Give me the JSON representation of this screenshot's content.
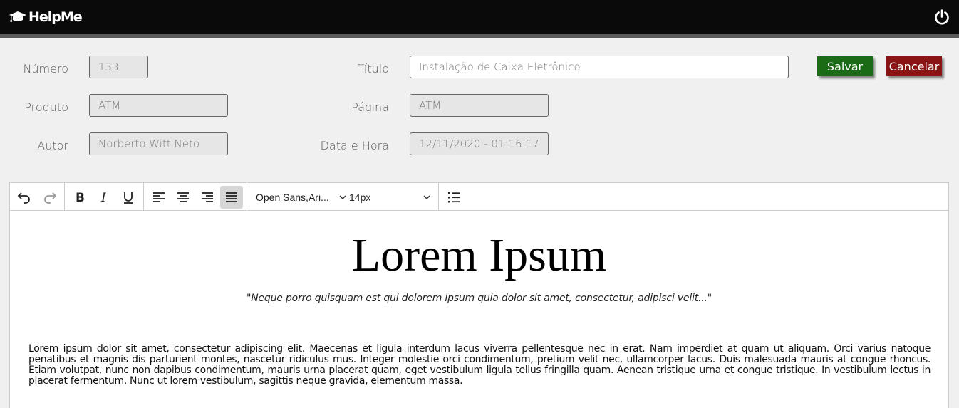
{
  "header": {
    "brand": "HelpMe",
    "brand_icon": "graduation-cap-icon",
    "power_icon": "power-icon"
  },
  "form": {
    "numero_label": "Número",
    "numero_value": "133",
    "titulo_label": "Título",
    "titulo_value": "Instalação de Caixa Eletrônico",
    "produto_label": "Produto",
    "produto_value": "ATM",
    "pagina_label": "Página",
    "pagina_value": "ATM",
    "autor_label": "Autor",
    "autor_value": "Norberto Witt Neto",
    "datahora_label": "Data e Hora",
    "datahora_value": "12/11/2020 - 01:16:17"
  },
  "actions": {
    "save_label": "Salvar",
    "cancel_label": "Cancelar",
    "save_color": "#1b6a16",
    "cancel_color": "#8a1314"
  },
  "toolbar": {
    "font_family": "Open Sans,Ari...",
    "font_size": "14px",
    "active_alignment": "justify"
  },
  "editor": {
    "heading": "Lorem Ipsum",
    "quote": "\"Neque porro quisquam est qui dolorem ipsum quia dolor sit amet, consectetur, adipisci velit...\"",
    "paragraph": "Lorem ipsum dolor sit amet, consectetur adipiscing elit. Maecenas et ligula interdum lacus viverra pellentesque nec in erat. Nam imperdiet at quam ut aliquam. Orci varius natoque penatibus et magnis dis parturient montes, nascetur ridiculus mus. Integer molestie orci condimentum, pretium velit nec, ullamcorper lacus. Duis malesuada mauris at congue rhoncus. Etiam volutpat, nunc non dapibus condimentum, mauris urna placerat quam, eget vestibulum ligula tellus fringilla quam. Aenean tristique urna et congue tristique. In vestibulum lectus in placerat fermentum. Nunc ut lorem vestibulum, sagittis neque gravida, elementum massa."
  }
}
